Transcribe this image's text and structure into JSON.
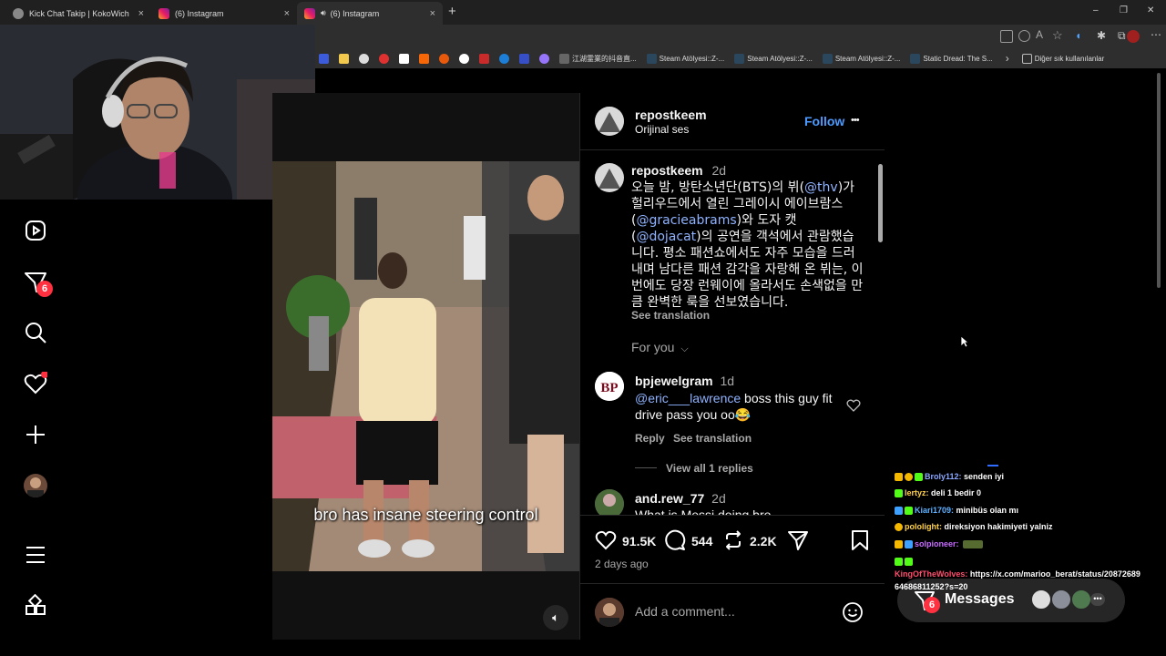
{
  "browser": {
    "tabs": [
      {
        "title": "Kick Chat Takip | KokoWich",
        "close": "×"
      },
      {
        "title": "(6) Instagram",
        "close": "×"
      },
      {
        "title": "(6) Instagram",
        "close": "×",
        "active": true
      }
    ],
    "new_tab": "+",
    "window_controls": {
      "minimize": "–",
      "restore": "❐",
      "close": "✕"
    },
    "bookmarks": [
      {
        "label": "江湖霊業的抖音直...",
        "color": "#111"
      },
      {
        "label": "Steam Atölyesi::Z-...",
        "color": "#1b2838"
      },
      {
        "label": "Steam Atölyesi::Z-...",
        "color": "#1b2838"
      },
      {
        "label": "Steam Atölyesi::Z-...",
        "color": "#1b2838"
      },
      {
        "label": "Static Dread: The S...",
        "color": "#1b2838"
      }
    ],
    "bookmarks_more": "›",
    "other_bookmarks": "Diğer sık kullanılanlar"
  },
  "sidebar": {
    "notification_count": "6"
  },
  "video": {
    "caption": "bro has insane steering control"
  },
  "post": {
    "username": "repostkeem",
    "audio": "Orijinal ses",
    "follow_label": "Follow",
    "more": "•••",
    "caption_user": "repostkeem",
    "caption_time": "2d",
    "caption_parts": {
      "p1": "오늘 밤, 방탄소년단(BTS)의 뷔(",
      "m1": "@thv",
      "p2": ")가 헐리우드에서 열린 그레이시 에이브람스 (",
      "m2": "@gracieabrams",
      "p3": ")와 도자 캣(",
      "m3": "@dojacat",
      "p4": ")의 공연을 객석에서 관람했습니다. 평소 패션쇼에서도 자주 모습을 드러내며 남다른 패션 감각을 자랑해 온 뷔는, 이번에도 당장 런웨이에 올라서도 손색없을 만큼 완벽한 룩을 선보였습니다."
    },
    "see_translation": "See translation",
    "for_you": "For you",
    "comments": [
      {
        "user": "bpjewelgram",
        "time": "1d",
        "mention": "@eric___lawrence",
        "text": " boss this guy fit drive pass you oo😂",
        "reply": "Reply",
        "translate": "See translation",
        "view_replies": "View all 1 replies"
      },
      {
        "user": "and.rew_77",
        "time": "2d",
        "text": "What is Messi doing bro"
      }
    ],
    "likes": "91.5K",
    "comments_count": "544",
    "reposts": "2.2K",
    "posted": "2 days ago",
    "add_comment_placeholder": "Add a comment..."
  },
  "messages": {
    "label": "Messages",
    "badge": "6"
  },
  "chat": [
    {
      "user": "Broly112:",
      "msg": " senden iyi",
      "color": "#8aa8ff"
    },
    {
      "user": "lertyz:",
      "msg": " deli 1 bedir 0",
      "color": "#ffd24a"
    },
    {
      "user": "Kiari1709:",
      "msg": " minibüs olan mı",
      "color": "#5fb0ff"
    },
    {
      "user": "pololight:",
      "msg": " direksiyon hakimiyeti yalniz",
      "color": "#ffd24a"
    },
    {
      "user": "solpioneer:",
      "msg": "",
      "color": "#c76bff"
    },
    {
      "user": "KingOfTheWolves:",
      "msg": " https://x.com/marioo_berat/status/20872689",
      "color": "#ff4d6d"
    },
    {
      "user": "",
      "msg": "64686811252?s=20",
      "color": "#fff"
    }
  ]
}
